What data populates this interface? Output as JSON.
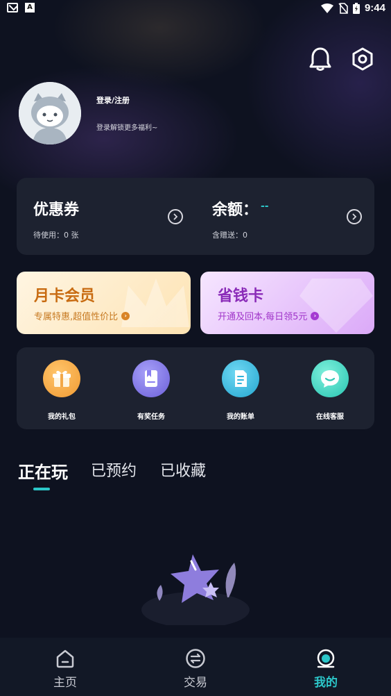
{
  "status_bar": {
    "time": "9:44"
  },
  "profile": {
    "login_label": "登录/注册",
    "login_sub": "登录解锁更多福利~"
  },
  "wallet": {
    "coupon_title": "优惠券",
    "coupon_sub": "待使用：0 张",
    "balance_title": "余额：",
    "balance_value": "--",
    "balance_sub": "含赠送：0"
  },
  "promos": {
    "month": {
      "title": "月卡会员",
      "sub": "专属特惠,超值性价比"
    },
    "save": {
      "title": "省钱卡",
      "sub": "开通及回本,每日领5元"
    }
  },
  "shortcuts": [
    {
      "label": "我的礼包",
      "icon": "gift-icon",
      "color": "#f4a440"
    },
    {
      "label": "有奖任务",
      "icon": "task-book-icon",
      "color": "#7d73e6"
    },
    {
      "label": "我的账单",
      "icon": "bill-document-icon",
      "color": "#2fb7d8"
    },
    {
      "label": "在线客服",
      "icon": "chat-service-icon",
      "color": "#3fd3c0"
    }
  ],
  "tabs": [
    {
      "label": "正在玩",
      "active": true
    },
    {
      "label": "已预约",
      "active": false
    },
    {
      "label": "已收藏",
      "active": false
    }
  ],
  "bottom_nav": [
    {
      "label": "主页",
      "icon": "home-icon",
      "active": false
    },
    {
      "label": "交易",
      "icon": "exchange-icon",
      "active": false
    },
    {
      "label": "我的",
      "icon": "profile-icon",
      "active": true
    }
  ],
  "colors": {
    "accent": "#2cc6c9",
    "background": "#0e1220",
    "card": "#1d2230"
  }
}
